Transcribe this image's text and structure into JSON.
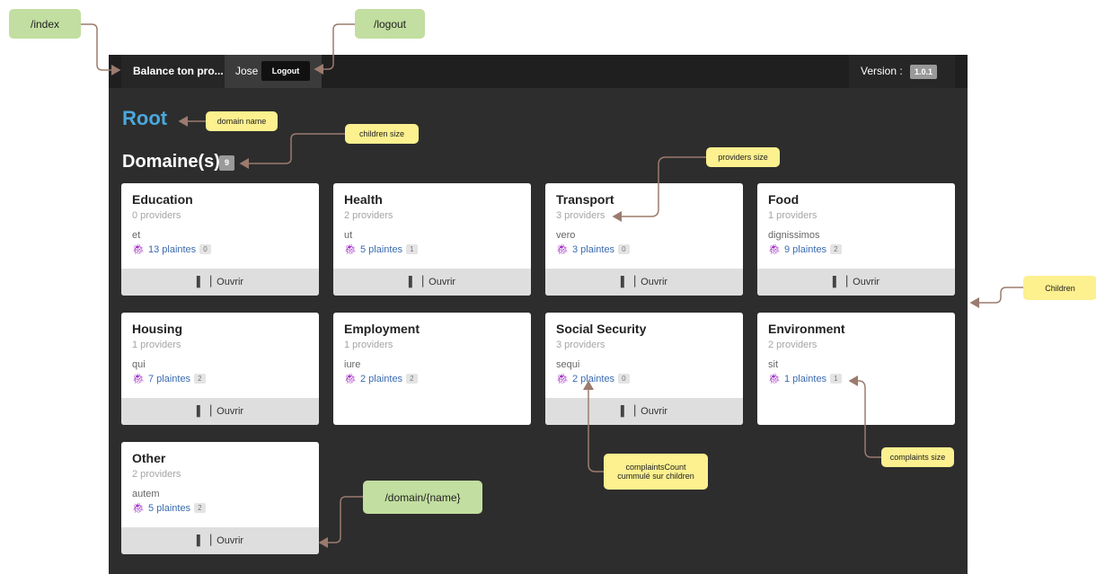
{
  "routes": {
    "index": "/index",
    "logout": "/logout",
    "domain": "/domain/{name}"
  },
  "header": {
    "brand": "Balance ton pro...",
    "user": "Jose",
    "logout_label": "Logout",
    "version_label": "Version :",
    "version": "1.0.1"
  },
  "domain": {
    "name": "Root",
    "section_title": "Domaine(s)",
    "children_count": "9"
  },
  "cards": [
    {
      "name": "Education",
      "providers": "0 providers",
      "word": "et",
      "complaints": "13 plaintes",
      "complaints_own": "0",
      "open": "Ouvrir"
    },
    {
      "name": "Health",
      "providers": "2 providers",
      "word": "ut",
      "complaints": "5 plaintes",
      "complaints_own": "1",
      "open": "Ouvrir"
    },
    {
      "name": "Transport",
      "providers": "3 providers",
      "word": "vero",
      "complaints": "3 plaintes",
      "complaints_own": "0",
      "open": "Ouvrir"
    },
    {
      "name": "Food",
      "providers": "1 providers",
      "word": "dignissimos",
      "complaints": "9 plaintes",
      "complaints_own": "2",
      "open": "Ouvrir"
    },
    {
      "name": "Housing",
      "providers": "1 providers",
      "word": "qui",
      "complaints": "7 plaintes",
      "complaints_own": "2",
      "open": "Ouvrir"
    },
    {
      "name": "Employment",
      "providers": "1 providers",
      "word": "iure",
      "complaints": "2 plaintes",
      "complaints_own": "2",
      "open": ""
    },
    {
      "name": "Social Security",
      "providers": "3 providers",
      "word": "sequi",
      "complaints": "2 plaintes",
      "complaints_own": "0",
      "open": "Ouvrir"
    },
    {
      "name": "Environment",
      "providers": "2 providers",
      "word": "sit",
      "complaints": "1 plaintes",
      "complaints_own": "1",
      "open": ""
    },
    {
      "name": "Other",
      "providers": "2 providers",
      "word": "autem",
      "complaints": "5 plaintes",
      "complaints_own": "2",
      "open": "Ouvrir"
    }
  ],
  "annotations": {
    "domain_name": "domain name",
    "children_size": "children size",
    "providers_size": "providers size",
    "children": "Children",
    "complaints_count_line1": "complaintsCount",
    "complaints_count_line2": "cummulé sur children",
    "complaints_size": "complaints size"
  },
  "colors": {
    "background": "#2d2d2d",
    "accent": "#4aa8dd",
    "bug": "#a028c4",
    "link": "#3a6ab0",
    "note": "#fcf08f",
    "route": "#c2dea0",
    "arrow": "#9b7b6e"
  },
  "icons": {
    "bug": "bug-icon",
    "open": "door-icon"
  }
}
